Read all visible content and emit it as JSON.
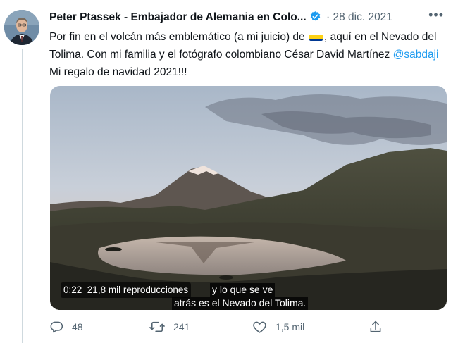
{
  "tweet": {
    "author_name": "Peter Ptassek - Embajador de Alemania en Colo...",
    "separator": "·",
    "date": "28 dic. 2021",
    "more_icon": "more-horizontal-icon",
    "text_before_flag": "Por fin en el volcán más emblemático (a mi juicio) de ",
    "flag": "colombia-flag",
    "text_after_flag": ", aquí en el Nevado del Tolima.  Con mi familia y el fotógrafo colombiano César David Martínez ",
    "mention": "@sabdaji",
    "text_end": " Mi regalo de navidad 2021!!!"
  },
  "video": {
    "time": "0:22",
    "views": "21,8 mil reproducciones",
    "subtitle_line1": "y lo que se ve",
    "subtitle_line2": "atrás es el Nevado del Tolima."
  },
  "actions": {
    "replies": "48",
    "retweets": "241",
    "likes": "1,5 mil"
  },
  "colors": {
    "verified": "#1d9bf0",
    "mention": "#1d9bf0",
    "secondary_text": "#536471"
  }
}
